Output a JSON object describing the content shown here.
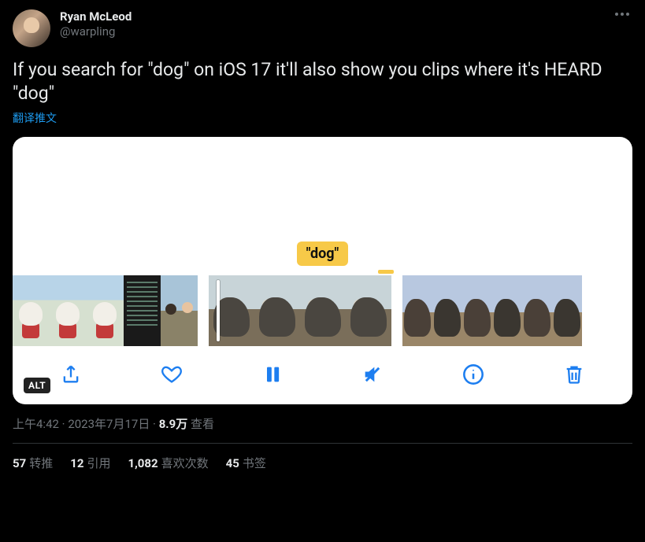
{
  "author": {
    "display_name": "Ryan McLeod",
    "handle": "@warpling"
  },
  "body_text": "If you search for \"dog\" on iOS 17 it'll also show you clips where it's HEARD \"dog\"",
  "translate_label": "翻译推文",
  "media": {
    "search_term_label": "\"dog\"",
    "alt_badge": "ALT",
    "toolbar_icons": {
      "share": "share-icon",
      "heart": "heart-icon",
      "pause": "pause-icon",
      "mute": "mute-icon",
      "info": "info-icon",
      "trash": "trash-icon"
    }
  },
  "meta": {
    "time": "上午4:42",
    "separator": " · ",
    "date": "2023年7月17日",
    "views_count": "8.9万",
    "views_label": " 查看"
  },
  "stats": {
    "retweets": {
      "count": "57",
      "label": "转推"
    },
    "quotes": {
      "count": "12",
      "label": "引用"
    },
    "likes": {
      "count": "1,082",
      "label": "喜欢次数"
    },
    "bookmarks": {
      "count": "45",
      "label": "书签"
    }
  }
}
